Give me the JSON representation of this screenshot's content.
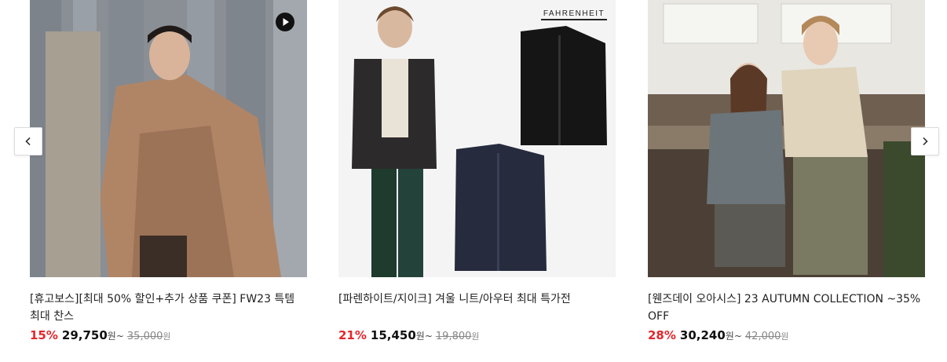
{
  "products": [
    {
      "title": "[휴고보스][최대 50% 할인+추가 상품 쿠폰] FW23 특템 최대 찬스",
      "discount": "15%",
      "price": "29,750",
      "price_unit": "원~",
      "original_price": "35,000",
      "original_unit": "원",
      "has_video": true
    },
    {
      "title": "[파렌하이트/지이크] 겨울 니트/아우터 최대 특가전",
      "discount": "21%",
      "price": "15,450",
      "price_unit": "원~",
      "original_price": "19,800",
      "original_unit": "원",
      "brand_logo": "FAHRENHEIT"
    },
    {
      "title": "[웬즈데이 오아시스] 23 AUTUMN COLLECTION ~35% OFF",
      "discount": "28%",
      "price": "30,240",
      "price_unit": "원~",
      "original_price": "42,000",
      "original_unit": "원"
    }
  ],
  "nav": {
    "prev_icon": "chevron-left-icon",
    "next_icon": "chevron-right-icon"
  },
  "colors": {
    "discount": "#e4262c",
    "border": "#dcdcdc"
  }
}
